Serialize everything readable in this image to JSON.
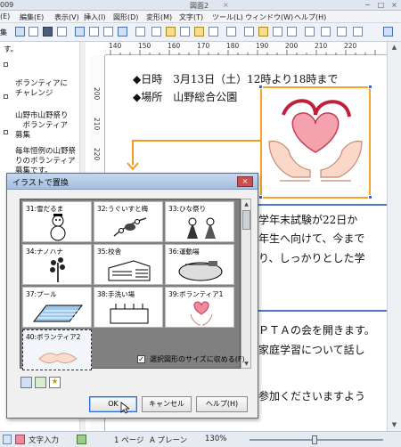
{
  "window": {
    "app_title": "009",
    "doc_title": "図面2",
    "doc_title_close": "×",
    "controls": [
      "─",
      "□",
      "×"
    ]
  },
  "menu": [
    "(E)",
    "編集(E)",
    "表示(V)",
    "挿入(I)",
    "図形(D)",
    "変形(M)",
    "文字(T)",
    "ツール(L)",
    "ウィンドウ(W)",
    "ヘルプ(H)"
  ],
  "toolbar": {
    "left_label": "集"
  },
  "outline": {
    "items": [
      {
        "text": "す。",
        "bullet": false
      },
      {
        "text": "ボランティアに\nチャレンジ",
        "bullet": true
      },
      {
        "text": "山野市山野祭り\n　ボランティア\n募集",
        "bullet": true
      },
      {
        "text": "毎年恒例の山野祭\nりのボランティア\n募集です。\nこの機会に、お祭\nりの裏方さんとし",
        "bullet": true
      }
    ]
  },
  "ruler": {
    "top_labels": [
      "140",
      "150",
      "160",
      "170",
      "180",
      "190",
      "200",
      "210",
      "220"
    ],
    "left_labels": [
      "200",
      "210",
      "220"
    ]
  },
  "document": {
    "line1": "◆日時　3月13日（土）12時より18時まで",
    "line2": "◆場所　山野総合公園",
    "para1_line1": "学年末試験が22日か",
    "para1_line2": "年生へ向けて、今まで",
    "para1_line3": "り、しっかりとした学",
    "para2_line1": "ＰＴＡの会を開きます。",
    "para2_line2": "家庭学習について話し",
    "para2_line3": "参加くださいますよう"
  },
  "dialog": {
    "title": "イラストで置換",
    "close": "×",
    "cells": [
      {
        "label": "31:雪だるま"
      },
      {
        "label": "32:うぐいすと梅"
      },
      {
        "label": "33:ひな祭り"
      },
      {
        "label": "34:ナノハナ"
      },
      {
        "label": "35:校舎"
      },
      {
        "label": "36:運動場"
      },
      {
        "label": "37:プール"
      },
      {
        "label": "38:手洗い場"
      },
      {
        "label": "39:ボランティア1"
      },
      {
        "label": "40:ボランティア2"
      }
    ],
    "checkbox_label": "選択図形のサイズに収める(F)",
    "checkbox_checked": true,
    "buttons": {
      "ok": "OK",
      "cancel": "キャンセル",
      "help": "ヘルプ(H)"
    }
  },
  "statusbar": {
    "mode": "文字入力",
    "page": "1 ページ",
    "plane": "A プレーン",
    "zoom": "130%"
  },
  "colors": {
    "accent_orange": "#f29b21",
    "selection_blue": "#4060c0",
    "rule_blue": "#4a78c4"
  }
}
